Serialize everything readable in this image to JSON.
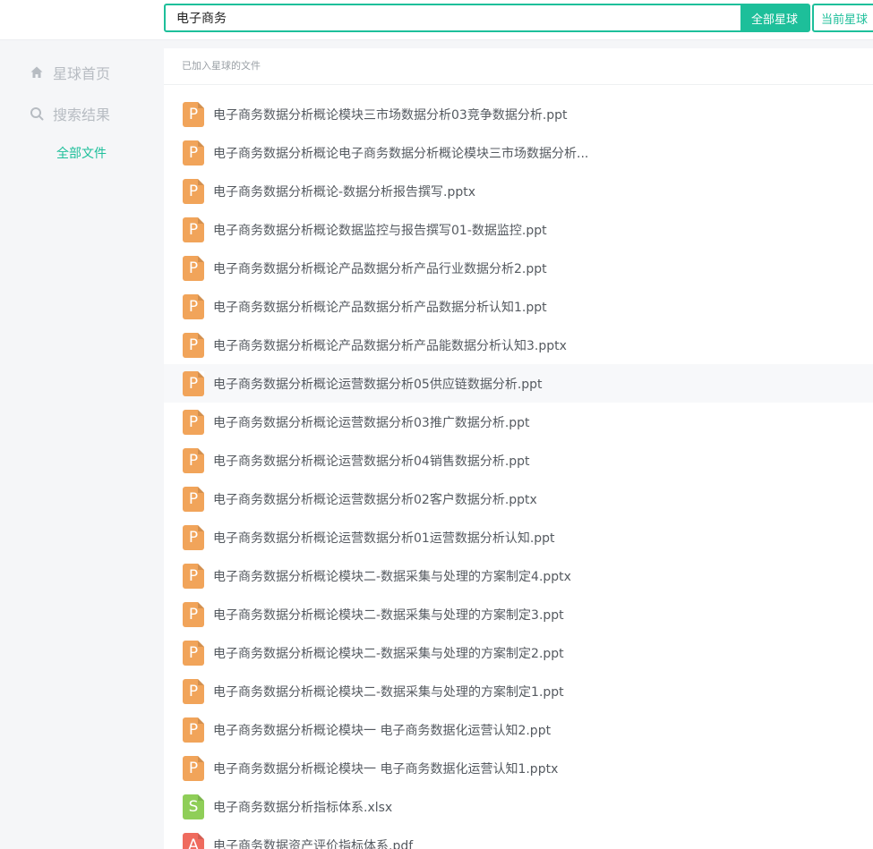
{
  "search": {
    "value": "电子商务",
    "btn_all": "全部星球",
    "btn_current": "当前星球"
  },
  "sidebar": {
    "items": [
      {
        "label": "星球首页",
        "icon": "home-icon"
      },
      {
        "label": "搜索结果",
        "icon": "search-icon"
      },
      {
        "label": "全部文件"
      }
    ]
  },
  "main": {
    "section_title": "已加入星球的文件",
    "files": [
      {
        "name": "电子商务数据分析概论模块三市场数据分析03竞争数据分析.ppt",
        "type": "ppt",
        "icon_letter": "P"
      },
      {
        "name": "电子商务数据分析概论电子商务数据分析概论模块三市场数据分析...",
        "type": "ppt",
        "icon_letter": "P"
      },
      {
        "name": "电子商务数据分析概论-数据分析报告撰写.pptx",
        "type": "ppt",
        "icon_letter": "P"
      },
      {
        "name": "电子商务数据分析概论数据监控与报告撰写01-数据监控.ppt",
        "type": "ppt",
        "icon_letter": "P"
      },
      {
        "name": "电子商务数据分析概论产品数据分析产品行业数据分析2.ppt",
        "type": "ppt",
        "icon_letter": "P"
      },
      {
        "name": "电子商务数据分析概论产品数据分析产品数据分析认知1.ppt",
        "type": "ppt",
        "icon_letter": "P"
      },
      {
        "name": "电子商务数据分析概论产品数据分析产品能数据分析认知3.pptx",
        "type": "ppt",
        "icon_letter": "P"
      },
      {
        "name": "电子商务数据分析概论运营数据分析05供应链数据分析.ppt",
        "type": "ppt",
        "icon_letter": "P"
      },
      {
        "name": "电子商务数据分析概论运营数据分析03推广数据分析.ppt",
        "type": "ppt",
        "icon_letter": "P"
      },
      {
        "name": "电子商务数据分析概论运营数据分析04销售数据分析.ppt",
        "type": "ppt",
        "icon_letter": "P"
      },
      {
        "name": "电子商务数据分析概论运营数据分析02客户数据分析.pptx",
        "type": "ppt",
        "icon_letter": "P"
      },
      {
        "name": "电子商务数据分析概论运营数据分析01运营数据分析认知.ppt",
        "type": "ppt",
        "icon_letter": "P"
      },
      {
        "name": "电子商务数据分析概论模块二-数据采集与处理的方案制定4.pptx",
        "type": "ppt",
        "icon_letter": "P"
      },
      {
        "name": "电子商务数据分析概论模块二-数据采集与处理的方案制定3.ppt",
        "type": "ppt",
        "icon_letter": "P"
      },
      {
        "name": "电子商务数据分析概论模块二-数据采集与处理的方案制定2.ppt",
        "type": "ppt",
        "icon_letter": "P"
      },
      {
        "name": "电子商务数据分析概论模块二-数据采集与处理的方案制定1.ppt",
        "type": "ppt",
        "icon_letter": "P"
      },
      {
        "name": "电子商务数据分析概论模块一 电子商务数据化运营认知2.ppt",
        "type": "ppt",
        "icon_letter": "P"
      },
      {
        "name": "电子商务数据分析概论模块一 电子商务数据化运营认知1.pptx",
        "type": "ppt",
        "icon_letter": "P"
      },
      {
        "name": "电子商务数据分析指标体系.xlsx",
        "type": "xls",
        "icon_letter": "S"
      },
      {
        "name": "电子商务数据资产评价指标体系.pdf",
        "type": "pdf",
        "icon_letter": "A"
      }
    ]
  },
  "colors": {
    "accent": "#1dbf9a",
    "ppt_icon": "#f1a45a",
    "xls_icon": "#8fce58",
    "pdf_icon": "#ef6b5e"
  }
}
